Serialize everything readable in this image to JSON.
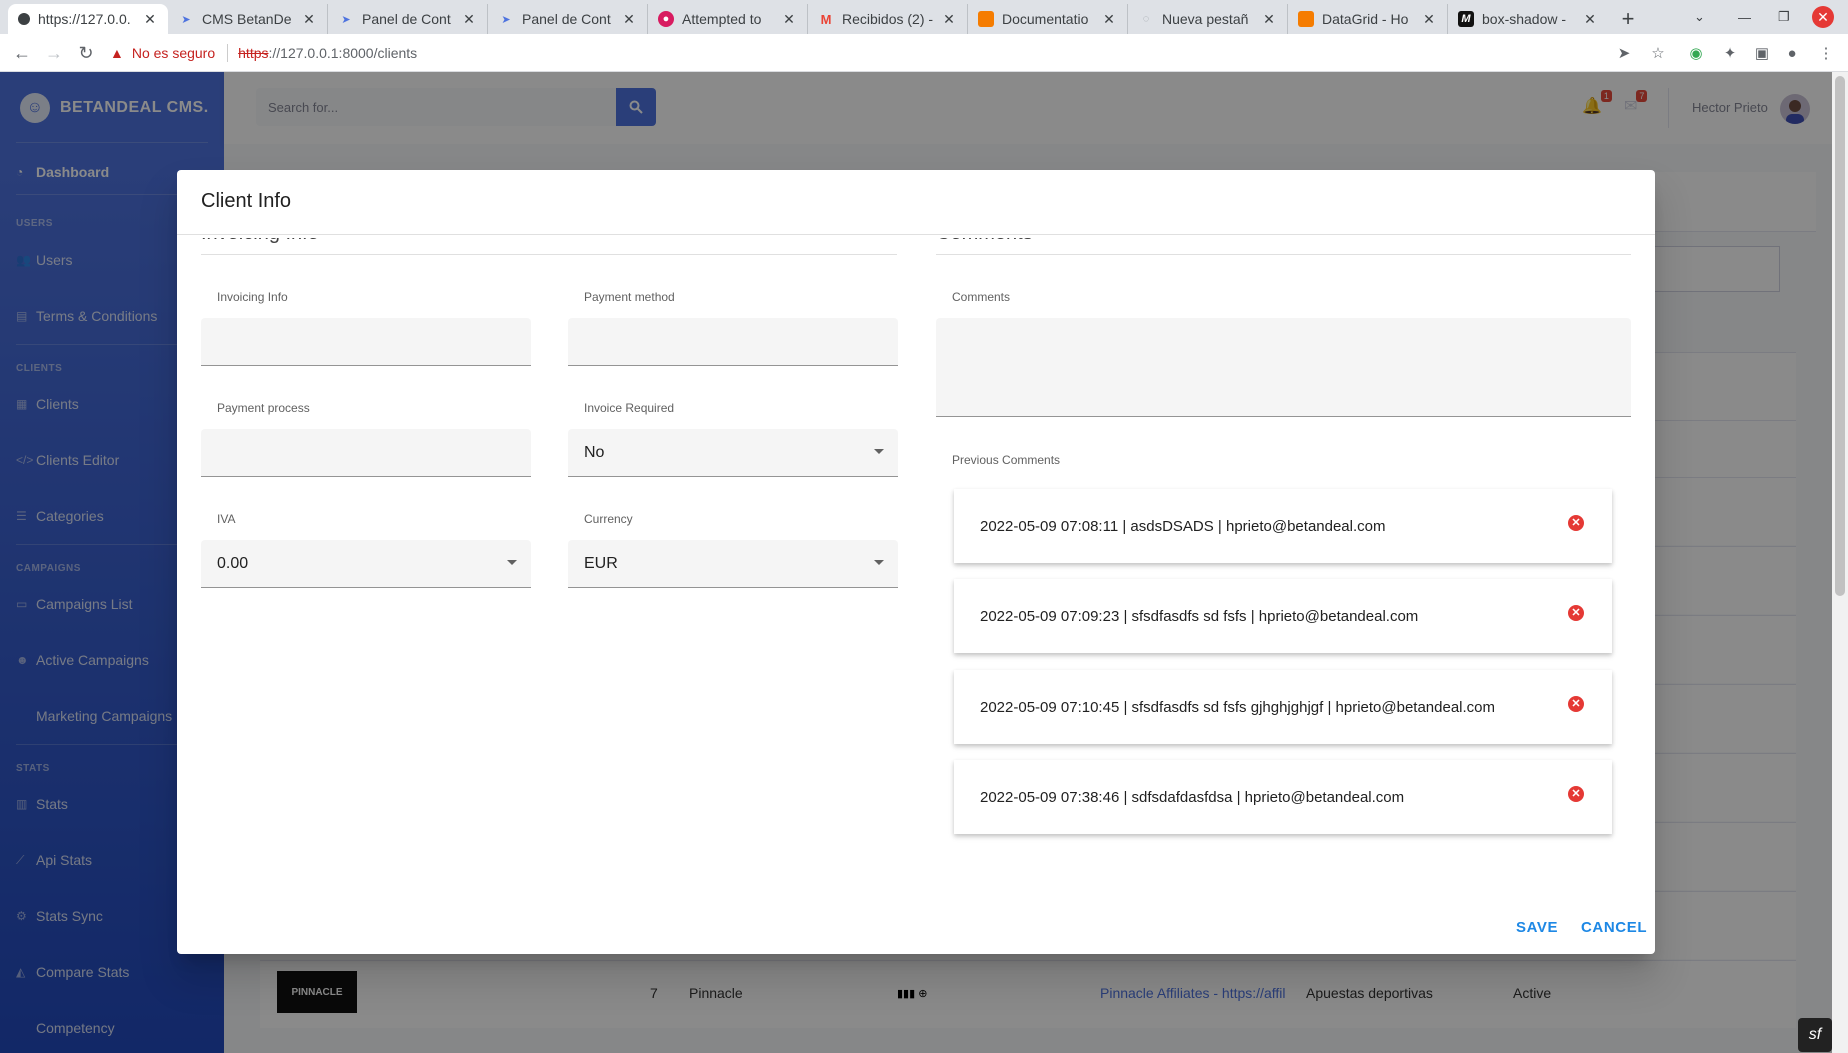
{
  "browser": {
    "tabs": [
      {
        "title": "https://127.0.0.",
        "active": true,
        "icon": "page-icon"
      },
      {
        "title": "CMS BetanDe",
        "icon": "feather-icon"
      },
      {
        "title": "Panel de Cont",
        "icon": "feather-icon"
      },
      {
        "title": "Panel de Cont",
        "icon": "feather-icon"
      },
      {
        "title": "Attempted to",
        "icon": "bug-icon"
      },
      {
        "title": "Recibidos (2) -",
        "icon": "mail-icon"
      },
      {
        "title": "Documentatio",
        "icon": "docs-icon"
      },
      {
        "title": "Nueva pestañ",
        "icon": "globe-icon"
      },
      {
        "title": "DataGrid - Ho",
        "icon": "docs-icon"
      },
      {
        "title": "box-shadow -",
        "icon": "m-icon"
      }
    ],
    "close_glyph": "✕",
    "new_tab_glyph": "+",
    "address": {
      "insecure_label": "No es seguro",
      "scheme": "https",
      "rest": "://127.0.0.1:8000/clients"
    }
  },
  "sidebar": {
    "brand": "BETANDEAL CMS.",
    "items": [
      {
        "type": "item",
        "label": "Dashboard",
        "icon": "tachometer-icon",
        "active": true
      },
      {
        "type": "heading",
        "label": "USERS"
      },
      {
        "type": "item",
        "label": "Users",
        "icon": "users-icon"
      },
      {
        "type": "item",
        "label": "Terms & Conditions",
        "icon": "file-icon"
      },
      {
        "type": "heading",
        "label": "CLIENTS"
      },
      {
        "type": "item",
        "label": "Clients",
        "icon": "briefcase-icon"
      },
      {
        "type": "item",
        "label": "Clients Editor",
        "icon": "code-icon"
      },
      {
        "type": "item",
        "label": "Categories",
        "icon": "list-icon"
      },
      {
        "type": "heading",
        "label": "CAMPAIGNS"
      },
      {
        "type": "item",
        "label": "Campaigns List",
        "icon": "table-icon"
      },
      {
        "type": "item",
        "label": "Active Campaigns",
        "icon": "user-check-icon"
      },
      {
        "type": "item",
        "label": "Marketing Campaigns",
        "icon": ""
      },
      {
        "type": "heading",
        "label": "STATS"
      },
      {
        "type": "item",
        "label": "Stats",
        "icon": "chart-icon"
      },
      {
        "type": "item",
        "label": "Api Stats",
        "icon": "line-chart-icon"
      },
      {
        "type": "item",
        "label": "Stats Sync",
        "icon": "cogs-icon"
      },
      {
        "type": "item",
        "label": "Compare Stats",
        "icon": "area-chart-icon"
      },
      {
        "type": "item",
        "label": "Competency",
        "icon": ""
      }
    ]
  },
  "topbar": {
    "search_placeholder": "Search for...",
    "alerts_count": "1",
    "messages_count": "7",
    "user_name": "Hector Prieto"
  },
  "background_row": {
    "logo": "PINNACLE",
    "id": "7",
    "name": "Pinnacle",
    "affiliate_link": "Pinnacle Affiliates - https://affil",
    "category": "Apuestas deportivas",
    "status": "Active"
  },
  "dialog": {
    "title": "Client Info",
    "invoicing": {
      "section_title": "Invoicing Info",
      "invoicing_info_label": "Invoicing Info",
      "invoicing_info_value": "",
      "payment_method_label": "Payment method",
      "payment_method_value": "",
      "payment_process_label": "Payment process",
      "payment_process_value": "",
      "invoice_required_label": "Invoice Required",
      "invoice_required_value": "No",
      "iva_label": "IVA",
      "iva_value": "0.00",
      "currency_label": "Currency",
      "currency_value": "EUR"
    },
    "comments": {
      "section_title": "Comments",
      "comments_label": "Comments",
      "previous_label": "Previous Comments",
      "list": [
        "2022-05-09 07:08:11 | asdsDSADS | hprieto@betandeal.com",
        "2022-05-09 07:09:23 | sfsdfasdfs sd fsfs | hprieto@betandeal.com",
        "2022-05-09 07:10:45 | sfsdfasdfs sd fsfs gjhghjghjgf | hprieto@betandeal.com",
        "2022-05-09 07:38:46 | sdfsdafdasfdsa | hprieto@betandeal.com"
      ]
    },
    "save_label": "SAVE",
    "cancel_label": "CANCEL"
  },
  "colors": {
    "sidebar_top": "#4e73df",
    "sidebar_bottom": "#224abe",
    "action_blue": "#1e88e5",
    "delete_red": "#e53935"
  }
}
